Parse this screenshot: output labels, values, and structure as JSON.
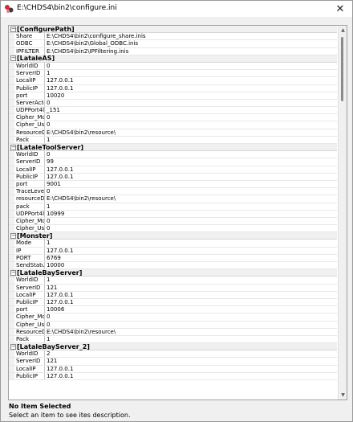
{
  "window": {
    "title": "E:\\CHDS4\\bin2\\configure.ini",
    "close_glyph": "✕"
  },
  "grid": {
    "categories": [
      {
        "name": "[ConfigurePath]",
        "props": [
          {
            "name": "Share",
            "value": "E:\\CHDS4\\bin2\\configure_share.inis"
          },
          {
            "name": "ODBC",
            "value": "E:\\CHDS4\\bin2\\Global_ODBC.inis"
          },
          {
            "name": "IPFILTER",
            "value": "E:\\CHDS4\\bin2\\IPFiltering.inis"
          }
        ]
      },
      {
        "name": "[LataleAS]",
        "props": [
          {
            "name": "WorldID",
            "value": "0"
          },
          {
            "name": "ServerID",
            "value": "1"
          },
          {
            "name": "LocalIP",
            "value": "127.0.0.1"
          },
          {
            "name": "PublicIP",
            "value": "127.0.0.1"
          },
          {
            "name": "port",
            "value": "10020"
          },
          {
            "name": "ServerActc",
            "value": "0"
          },
          {
            "name": "UDPPort4l",
            "value": "_151"
          },
          {
            "name": "Cipher_Mc",
            "value": "0"
          },
          {
            "name": "Cipher_Us",
            "value": "0"
          },
          {
            "name": "ResourceD",
            "value": "E:\\CHDS4\\bin2\\resource\\"
          },
          {
            "name": "Pack",
            "value": "1"
          }
        ]
      },
      {
        "name": "[LataleToolServer]",
        "props": [
          {
            "name": "WorldID",
            "value": "0"
          },
          {
            "name": "ServerID",
            "value": "99"
          },
          {
            "name": "LocalIP",
            "value": "127.0.0.1"
          },
          {
            "name": "PublicIP",
            "value": "127.0.0.1"
          },
          {
            "name": "port",
            "value": "9001"
          },
          {
            "name": "TraceLeve",
            "value": "0"
          },
          {
            "name": "resourceD",
            "value": "E:\\CHDS4\\bin2\\resource\\"
          },
          {
            "name": "pack",
            "value": "1"
          },
          {
            "name": "UDPPort4l",
            "value": "10999"
          },
          {
            "name": "Cipher_Mc",
            "value": "0"
          },
          {
            "name": "Cipher_Us",
            "value": "0"
          }
        ]
      },
      {
        "name": "[Monster]",
        "props": [
          {
            "name": "Mode",
            "value": "1"
          },
          {
            "name": "IP",
            "value": "127.0.0.1"
          },
          {
            "name": "PORT",
            "value": "6769"
          },
          {
            "name": "SendStatu",
            "value": "10000"
          }
        ]
      },
      {
        "name": "[LataleBayServer]",
        "props": [
          {
            "name": "WorldID",
            "value": "1"
          },
          {
            "name": "ServerID",
            "value": "121"
          },
          {
            "name": "LocalIP",
            "value": "127.0.0.1"
          },
          {
            "name": "PublicIP",
            "value": "127.0.0.1"
          },
          {
            "name": "port",
            "value": "10006"
          },
          {
            "name": "Cipher_Mc",
            "value": "0"
          },
          {
            "name": "Cipher_Us",
            "value": "0"
          },
          {
            "name": "ResourceD",
            "value": "E:\\CHDS4\\bin2\\resource\\"
          },
          {
            "name": "Pack",
            "value": "1"
          }
        ]
      },
      {
        "name": "[LataleBayServer_2]",
        "props": [
          {
            "name": "WorldID",
            "value": "2"
          },
          {
            "name": "ServerID",
            "value": "121"
          },
          {
            "name": "LocalIP",
            "value": "127.0.0.1"
          },
          {
            "name": "PublicIP",
            "value": "127.0.0.1"
          }
        ]
      }
    ]
  },
  "description": {
    "title": "No Item Selected",
    "text": "Select an item to see ites description."
  },
  "colors": {
    "icon_red": "#d62a3c",
    "icon_dark": "#3c3c3c"
  }
}
